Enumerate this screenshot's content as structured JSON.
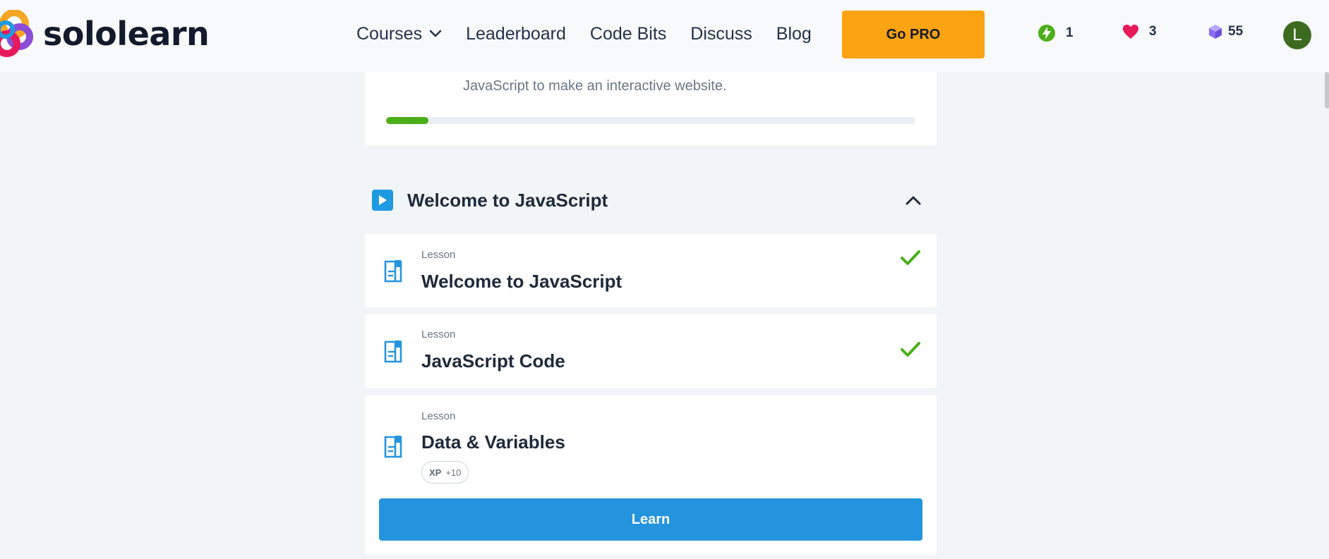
{
  "header": {
    "logo_text": "sololearn",
    "nav": [
      {
        "label": "Courses",
        "has_dropdown": true
      },
      {
        "label": "Leaderboard"
      },
      {
        "label": "Code Bits"
      },
      {
        "label": "Discuss"
      },
      {
        "label": "Blog"
      }
    ],
    "go_pro_label": "Go PRO",
    "stats": {
      "streak": "1",
      "hearts": "3",
      "bits": "55"
    },
    "avatar_initial": "L"
  },
  "course_intro": {
    "description_visible": "JavaScript to make an interactive website.",
    "progress_fraction": 0.08
  },
  "module": {
    "title": "Welcome to JavaScript",
    "expanded": true,
    "lessons": [
      {
        "type": "Lesson",
        "title": "Welcome to JavaScript",
        "completed": true
      },
      {
        "type": "Lesson",
        "title": "JavaScript Code",
        "completed": true
      },
      {
        "type": "Lesson",
        "title": "Data & Variables",
        "completed": false,
        "xp_label": "XP",
        "xp_value": "+10",
        "action_label": "Learn"
      }
    ]
  },
  "colors": {
    "accent_blue": "#2594df",
    "go_pro_orange": "#fca311",
    "success_green": "#4caf1a",
    "heart_red": "#e6195a",
    "bits_purple": "#8b6df0"
  }
}
